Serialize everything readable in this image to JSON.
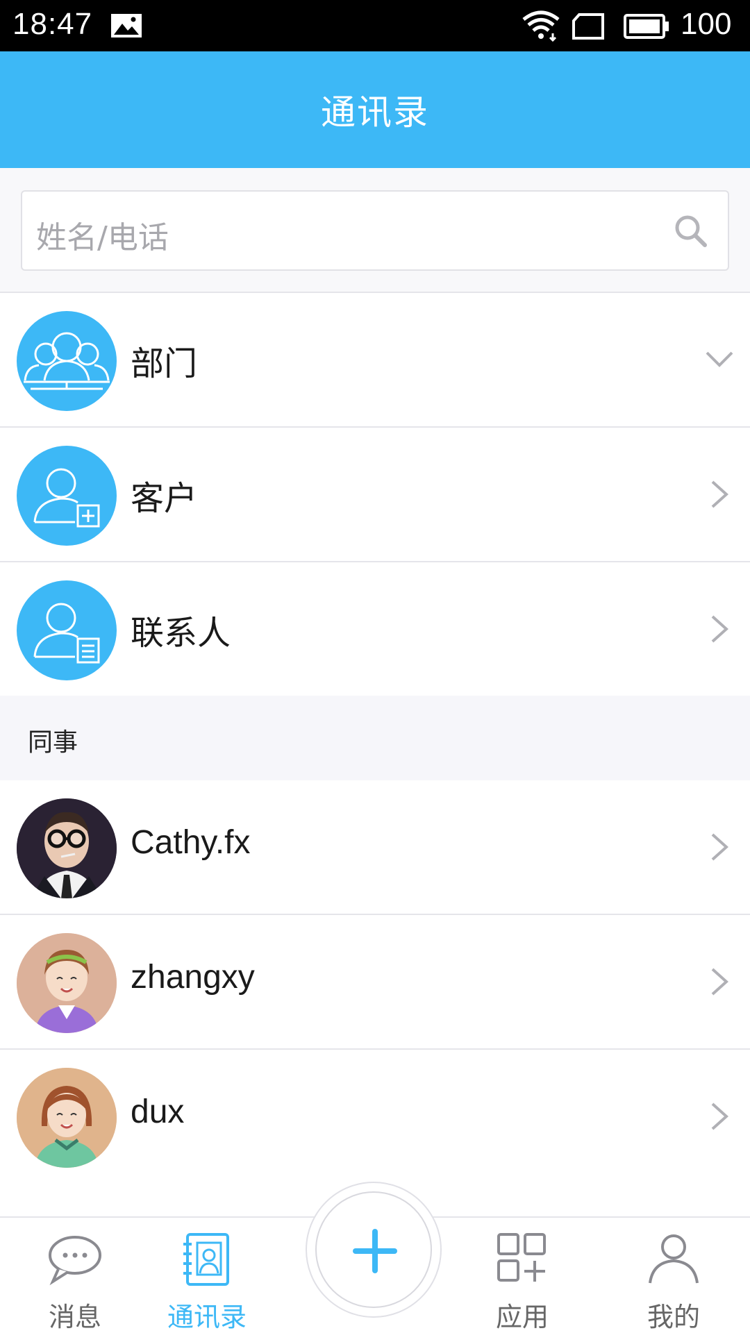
{
  "status_bar": {
    "time": "18:47",
    "battery": "100"
  },
  "header": {
    "title": "通讯录"
  },
  "search": {
    "placeholder": "姓名/电话"
  },
  "groups": [
    {
      "label": "部门",
      "icon": "department-icon",
      "chevron": "chevron-down"
    },
    {
      "label": "客户",
      "icon": "customer-add-icon",
      "chevron": "chevron-right"
    },
    {
      "label": "联系人",
      "icon": "contact-card-icon",
      "chevron": "chevron-right"
    }
  ],
  "section": {
    "title": "同事"
  },
  "colleagues": [
    {
      "name": "Cathy.fx",
      "avatar": "boy-glasses-avatar"
    },
    {
      "name": "zhangxy",
      "avatar": "girl-headband-avatar"
    },
    {
      "name": "dux",
      "avatar": "girl-bob-avatar"
    }
  ],
  "bottom_nav": {
    "items": [
      {
        "label": "消息",
        "icon": "chat-bubble-icon",
        "active": false
      },
      {
        "label": "通讯录",
        "icon": "address-book-icon",
        "active": true
      },
      {
        "label": "应用",
        "icon": "apps-grid-icon",
        "active": false
      },
      {
        "label": "我的",
        "icon": "person-icon",
        "active": false
      }
    ],
    "center_action": "add-plus-icon"
  },
  "colors": {
    "accent": "#3db8f6",
    "divider": "#e5e5ea",
    "section_bg": "#f6f6fa"
  }
}
